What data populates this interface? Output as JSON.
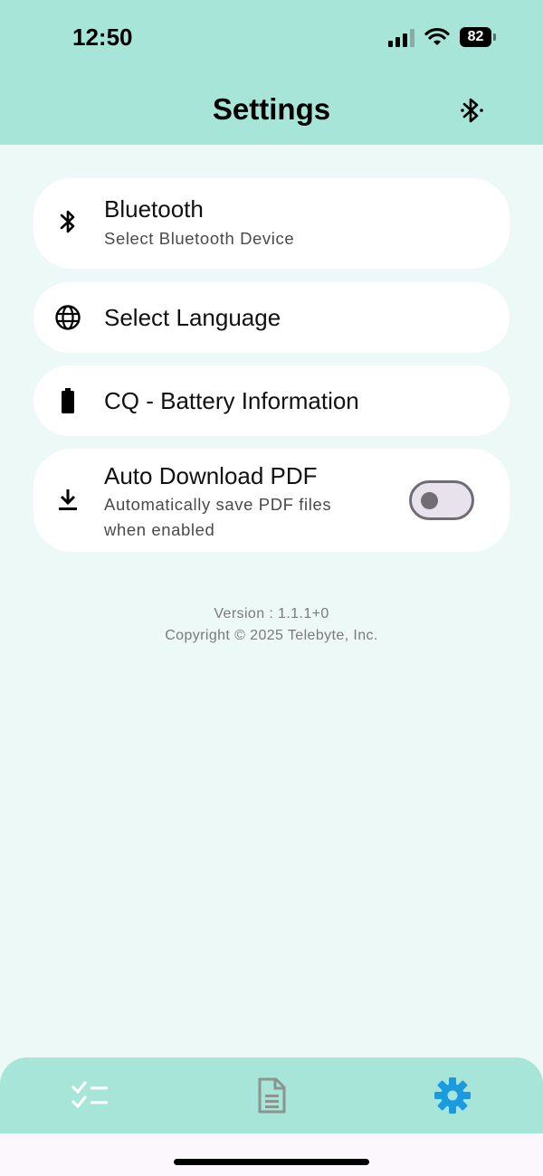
{
  "status_bar": {
    "time": "12:50",
    "battery": "82"
  },
  "header": {
    "title": "Settings",
    "action_icon": "bluetooth-searching-icon"
  },
  "settings": {
    "bluetooth": {
      "icon": "bluetooth-icon",
      "title": "Bluetooth",
      "subtitle": "Select Bluetooth Device"
    },
    "language": {
      "icon": "globe-icon",
      "title": "Select Language"
    },
    "battery": {
      "icon": "battery-icon",
      "title": "CQ - Battery Information"
    },
    "auto_pdf": {
      "icon": "download-icon",
      "title": "Auto Download PDF",
      "subtitle": "Automatically save PDF files when enabled",
      "enabled": false
    }
  },
  "footer": {
    "version": "Version : 1.1.1+0",
    "copyright": "Copyright © 2025 Telebyte, Inc."
  },
  "bottom_nav": {
    "items": [
      {
        "name": "checklist",
        "icon": "checklist-icon",
        "active": false
      },
      {
        "name": "document",
        "icon": "document-icon",
        "active": false
      },
      {
        "name": "settings",
        "icon": "gear-icon",
        "active": true
      }
    ]
  },
  "colors": {
    "header_bg": "#a6e5d8",
    "page_bg": "#ecf9f7",
    "active_nav": "#1a9be0",
    "inactive_nav": "#8a9592"
  }
}
